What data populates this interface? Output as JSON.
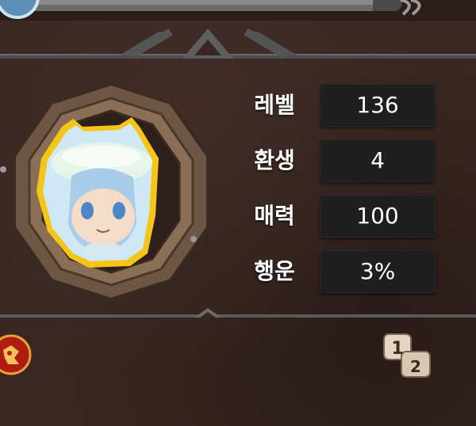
{
  "stats": [
    {
      "label": "레벨",
      "value": "136"
    },
    {
      "label": "환생",
      "value": "4"
    },
    {
      "label": "매력",
      "value": "100"
    },
    {
      "label": "행운",
      "value": "3%"
    }
  ],
  "icons": {
    "portrait": "character-portrait-icon",
    "badge": "red-emblem-icon",
    "page_switch": "page-1-2-toggle-icon"
  },
  "page_switch": {
    "first": "1",
    "second": "2"
  },
  "colors": {
    "background": "#3a2723",
    "value_box": "#1f1f1f",
    "frame": "#8a6e55",
    "text": "#ffffff"
  }
}
